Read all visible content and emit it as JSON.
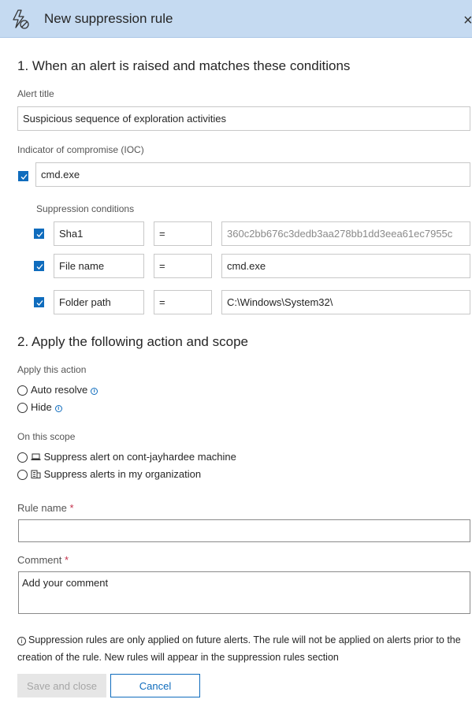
{
  "header": {
    "title": "New suppression rule",
    "close": "×"
  },
  "section1": {
    "title": "1. When an alert is raised and matches these conditions",
    "alert_title_label": "Alert title",
    "alert_title_value": "Suspicious sequence of exploration activities",
    "ioc_label": "Indicator of compromise (IOC)",
    "ioc_value": "cmd.exe",
    "ioc_checked": true,
    "suppression_label": "Suppression conditions",
    "conditions": [
      {
        "field": "Sha1",
        "operator": "=",
        "value": "360c2bb676c3dedb3aa278bb1dd3eea61ec7955c",
        "checked": true
      },
      {
        "field": "File name",
        "operator": "=",
        "value": "cmd.exe",
        "checked": true
      },
      {
        "field": "Folder path",
        "operator": "=",
        "value": "C:\\Windows\\System32\\",
        "checked": true
      }
    ]
  },
  "section2": {
    "title": "2. Apply the following action and scope",
    "action_label": "Apply this action",
    "actions": [
      {
        "label": "Auto resolve",
        "icon": "info-icon"
      },
      {
        "label": "Hide",
        "icon": "info-icon"
      }
    ],
    "scope_label": "On this scope",
    "scopes": [
      {
        "label": "Suppress alert on cont-jayhardee machine",
        "icon": "laptop-icon"
      },
      {
        "label": "Suppress alerts in my organization",
        "icon": "building-icon"
      }
    ]
  },
  "rule_name": {
    "label": "Rule name",
    "required_mark": "*",
    "value": ""
  },
  "comment": {
    "label": "Comment",
    "required_mark": "*",
    "placeholder": "Add your comment"
  },
  "note": "Suppression rules are only applied on future alerts. The rule will not be applied on alerts prior to the creation of the rule. New rules will appear in the suppression rules section",
  "buttons": {
    "save": "Save and close",
    "cancel": "Cancel"
  },
  "colors": {
    "header_bg": "#c5daf1",
    "accent": "#0f6cbd",
    "required": "#c4314b"
  }
}
